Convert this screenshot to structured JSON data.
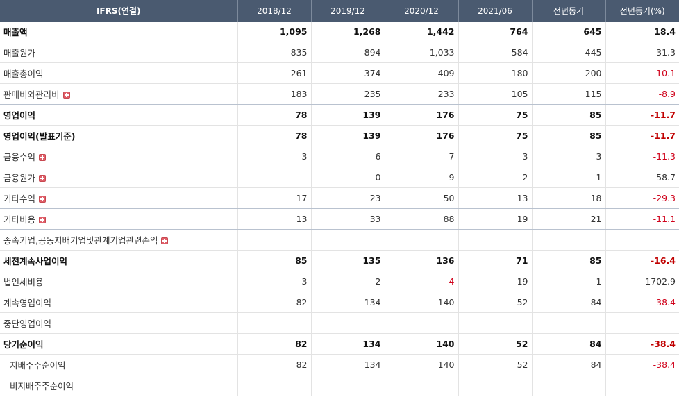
{
  "header": {
    "title": "IFRS(연결)",
    "columns": [
      "2018/12",
      "2019/12",
      "2020/12",
      "2021/06",
      "전년동기",
      "전년동기(%)"
    ]
  },
  "rows": [
    {
      "label": "매출액",
      "values": [
        "1,095",
        "1,268",
        "1,442",
        "764",
        "645",
        "18.4"
      ]
    },
    {
      "label": "매출원가",
      "values": [
        "835",
        "894",
        "1,033",
        "584",
        "445",
        "31.3"
      ]
    },
    {
      "label": "매출총이익",
      "values": [
        "261",
        "374",
        "409",
        "180",
        "200",
        "-10.1"
      ]
    },
    {
      "label": "판매비와관리비",
      "values": [
        "183",
        "235",
        "233",
        "105",
        "115",
        "-8.9"
      ]
    },
    {
      "label": "영업이익",
      "values": [
        "78",
        "139",
        "176",
        "75",
        "85",
        "-11.7"
      ]
    },
    {
      "label": "영업이익(발표기준)",
      "values": [
        "78",
        "139",
        "176",
        "75",
        "85",
        "-11.7"
      ]
    },
    {
      "label": "금융수익",
      "values": [
        "3",
        "6",
        "7",
        "3",
        "3",
        "-11.3"
      ]
    },
    {
      "label": "금융원가",
      "values": [
        "",
        "0",
        "9",
        "2",
        "1",
        "58.7"
      ]
    },
    {
      "label": "기타수익",
      "values": [
        "17",
        "23",
        "50",
        "13",
        "18",
        "-29.3"
      ]
    },
    {
      "label": "기타비용",
      "values": [
        "13",
        "33",
        "88",
        "19",
        "21",
        "-11.1"
      ]
    },
    {
      "label": "종속기업,공동지배기업및관계기업관련손익",
      "values": [
        "",
        "",
        "",
        "",
        "",
        ""
      ]
    },
    {
      "label": "세전계속사업이익",
      "values": [
        "85",
        "135",
        "136",
        "71",
        "85",
        "-16.4"
      ]
    },
    {
      "label": "법인세비용",
      "values": [
        "3",
        "2",
        "-4",
        "19",
        "1",
        "1702.9"
      ]
    },
    {
      "label": "계속영업이익",
      "values": [
        "82",
        "134",
        "140",
        "52",
        "84",
        "-38.4"
      ]
    },
    {
      "label": "중단영업이익",
      "values": [
        "",
        "",
        "",
        "",
        "",
        ""
      ]
    },
    {
      "label": "당기순이익",
      "values": [
        "82",
        "134",
        "140",
        "52",
        "84",
        "-38.4"
      ]
    },
    {
      "label": "지배주주순이익",
      "values": [
        "82",
        "134",
        "140",
        "52",
        "84",
        "-38.4"
      ]
    },
    {
      "label": "비지배주주순이익",
      "values": [
        "",
        "",
        "",
        "",
        "",
        ""
      ]
    }
  ],
  "colors": {
    "header_bg": "#4a5a70",
    "negative": "#d0021b",
    "expand_icon": "#e0606a"
  },
  "icons": {
    "expand": "plus-box-icon"
  }
}
